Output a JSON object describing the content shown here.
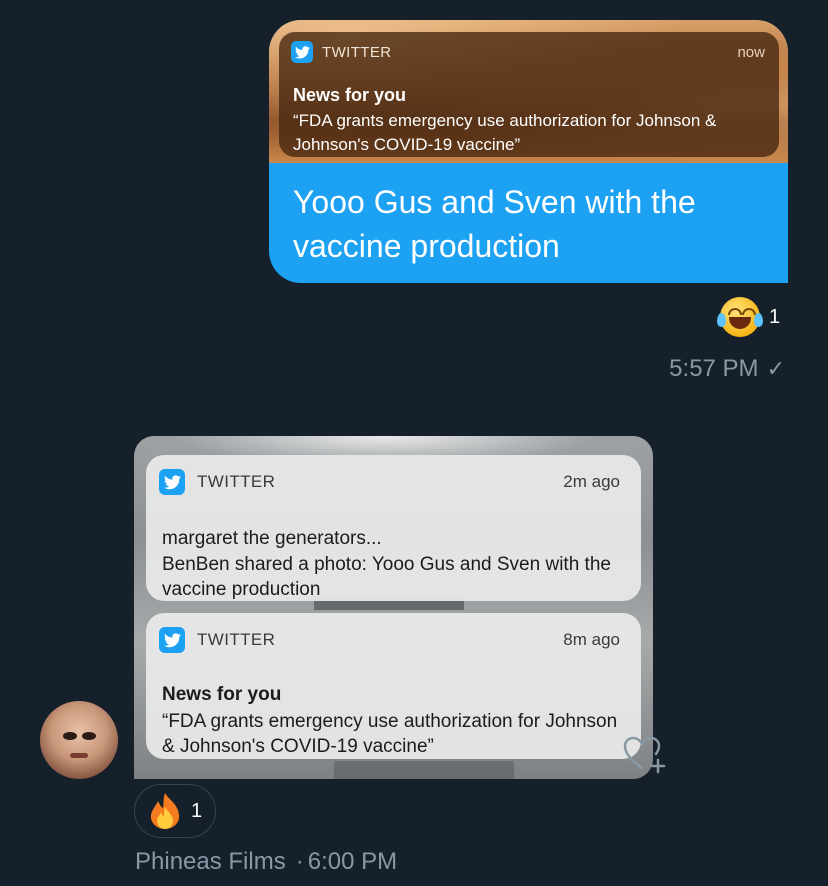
{
  "colors": {
    "background": "#15202b",
    "accent": "#1da1f2",
    "meta_text": "#8899a6"
  },
  "outgoing": {
    "notification": {
      "app": "TWITTER",
      "time": "now",
      "title": "News for you",
      "body": "“FDA grants emergency use authorization for Johnson & Johnson's COVID-19 vaccine”"
    },
    "text": "Yooo Gus and Sven with the vaccine production",
    "reaction": {
      "emoji": "face-with-tears-of-joy-icon",
      "count": "1"
    },
    "timestamp": "5:57 PM",
    "status_icon": "check-icon",
    "status_glyph": "✓"
  },
  "incoming": {
    "sender": "Phineas Films",
    "separator": "·",
    "timestamp": "6:00 PM",
    "notifications": [
      {
        "app": "TWITTER",
        "time": "2m ago",
        "line1": "margaret the generators...",
        "body": "BenBen shared a photo: Yooo Gus and Sven with the vaccine production"
      },
      {
        "app": "TWITTER",
        "time": "8m ago",
        "line1": "News for you",
        "body": "“FDA grants emergency use authorization for Johnson & Johnson's COVID-19 vaccine”"
      }
    ],
    "reaction": {
      "emoji": "fire-icon",
      "count": "1"
    },
    "add_reaction_icon": "heart-plus-icon"
  }
}
